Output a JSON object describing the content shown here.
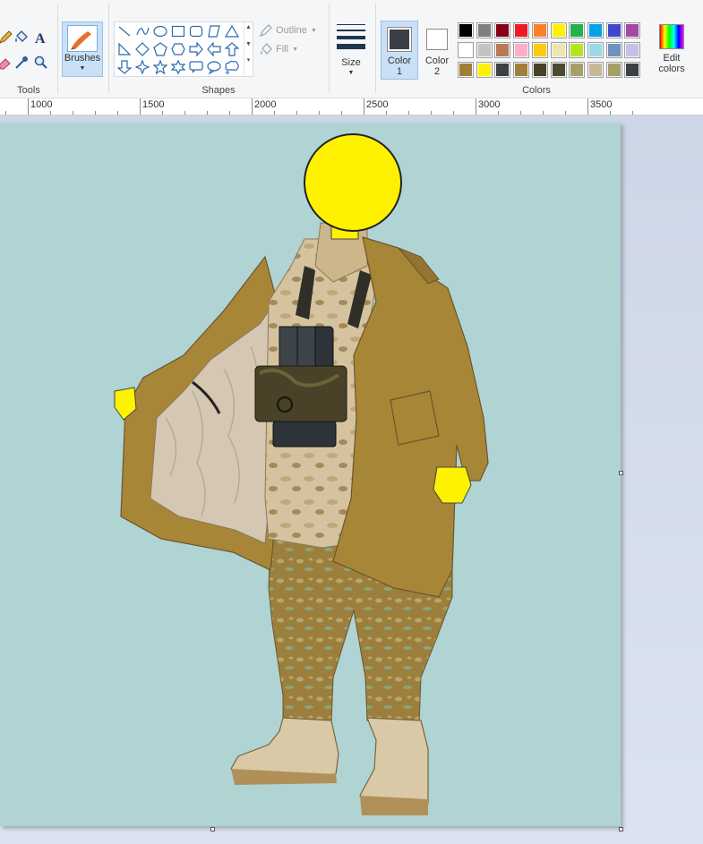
{
  "ribbon": {
    "tools": {
      "group_label": "Tools"
    },
    "brushes": {
      "label": "Brushes"
    },
    "shapes": {
      "group_label": "Shapes",
      "outline_label": "Outline",
      "fill_label": "Fill",
      "gallery": [
        "line",
        "curve",
        "oval",
        "rectangle",
        "rounded-rectangle",
        "polygon",
        "triangle",
        "right-triangle",
        "diamond",
        "pentagon",
        "hexagon",
        "right-arrow",
        "left-arrow",
        "up-arrow",
        "down-arrow",
        "four-point-star",
        "five-point-star",
        "six-point-star",
        "rounded-callout",
        "oval-callout",
        "cloud-callout"
      ]
    },
    "size": {
      "label": "Size"
    },
    "colors": {
      "group_label": "Colors",
      "color1_label": "Color",
      "color1_num": "1",
      "color2_label": "Color",
      "color2_num": "2",
      "color1_value": "#3b3f46",
      "color2_value": "#ffffff",
      "edit_label_1": "Edit",
      "edit_label_2": "colors",
      "palette": [
        [
          "#000000",
          "#7f7f7f",
          "#880015",
          "#ed1c24",
          "#ff7f27",
          "#fff200",
          "#22b14c",
          "#00a2e8",
          "#3f48cc",
          "#a349a4"
        ],
        [
          "#ffffff",
          "#c3c3c3",
          "#b97a57",
          "#ffaec9",
          "#ffc90e",
          "#efe4b0",
          "#b5e61d",
          "#99d9ea",
          "#7092be",
          "#c8bfe7"
        ],
        [
          "#a08038",
          "#fff200",
          "#3b3f46",
          "#a08038",
          "#4a3f2a",
          "#4d4a33",
          "#a4a068",
          "#c8b89a",
          "#a4a068",
          "#3b3f46"
        ]
      ]
    }
  },
  "ruler": {
    "labels": [
      "1000",
      "1500",
      "2000",
      "2500",
      "3000",
      "3500"
    ]
  },
  "canvas": {
    "background": "#b0d3d3"
  }
}
